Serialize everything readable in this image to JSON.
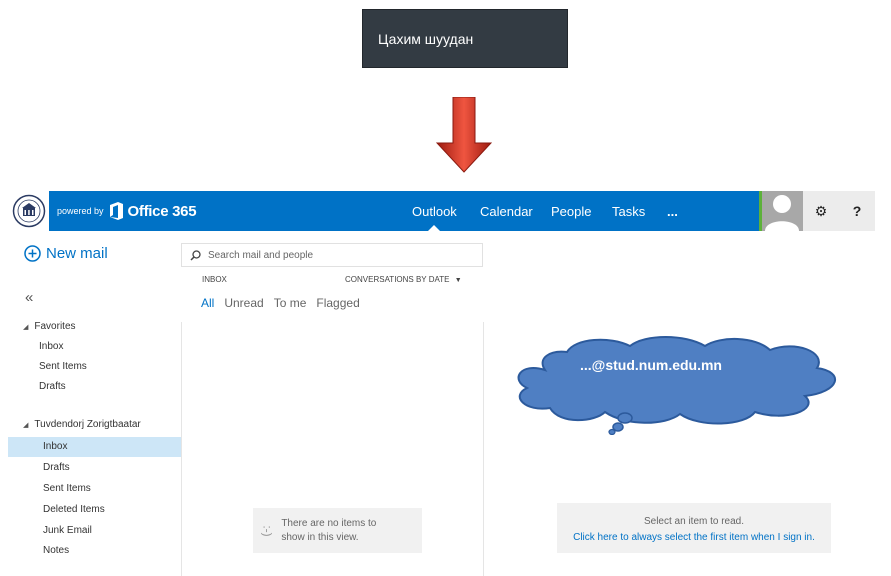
{
  "banner": {
    "text": "Цахим шуудан"
  },
  "header": {
    "powered_by": "powered by",
    "brand": "Office 365",
    "nav": [
      "Outlook",
      "Calendar",
      "People",
      "Tasks",
      "..."
    ],
    "active_nav": "Outlook",
    "settings_icon": "gear-icon",
    "help_label": "?"
  },
  "sidebar": {
    "new_mail": "New mail",
    "collapse": "«",
    "favorites": {
      "label": "Favorites",
      "items": [
        "Inbox",
        "Sent Items",
        "Drafts"
      ]
    },
    "account": {
      "label": "Tuvdendorj Zorigtbaatar",
      "items": [
        "Inbox",
        "Drafts",
        "Sent Items",
        "Deleted Items",
        "Junk Email",
        "Notes"
      ],
      "selected": "Inbox"
    }
  },
  "list": {
    "search_placeholder": "Search mail and people",
    "folder_label": "INBOX",
    "sort_label": "CONVERSATIONS BY DATE",
    "filters": [
      "All",
      "Unread",
      "To me",
      "Flagged"
    ],
    "selected_filter": "All",
    "empty_face": ":-)",
    "empty_text_1": "There are no items to",
    "empty_text_2": "show in this view."
  },
  "reading": {
    "line1": "Select an item to read.",
    "line2": "Click here to always select the first item when I sign in."
  },
  "callout": {
    "text": "...@stud.num.edu.mn"
  },
  "colors": {
    "office_blue": "#0072c6",
    "banner_bg": "#333b43",
    "arrow_red": "#d83a2a",
    "cloud_blue": "#4f7fc3"
  }
}
